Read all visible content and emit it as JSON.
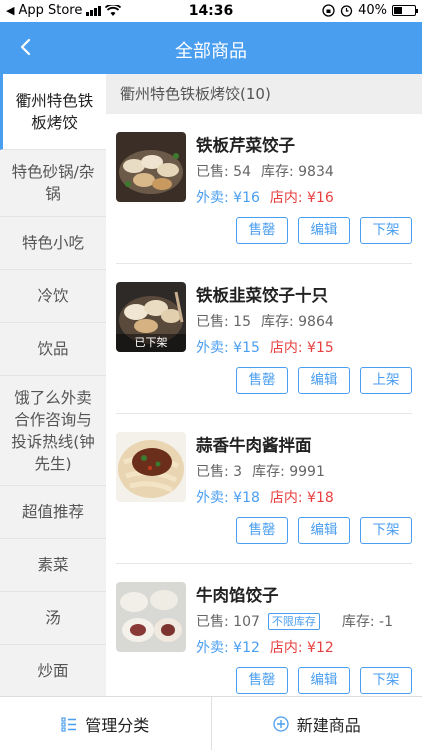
{
  "status_bar": {
    "carrier": "App Store",
    "time": "14:36",
    "battery": "40%",
    "battery_level": 0.4
  },
  "nav": {
    "title": "全部商品"
  },
  "sidebar": {
    "items": [
      {
        "label": "衢州特色铁板烤饺",
        "active": true
      },
      {
        "label": "特色砂锅/杂锅"
      },
      {
        "label": "特色小吃"
      },
      {
        "label": "冷饮"
      },
      {
        "label": "饮品"
      },
      {
        "label": "饿了么外卖合作咨询与投诉热线(钟先生)"
      },
      {
        "label": "超值推荐"
      },
      {
        "label": "素菜"
      },
      {
        "label": "汤"
      },
      {
        "label": "炒面"
      }
    ]
  },
  "section": {
    "title": "衢州特色铁板烤饺(10)"
  },
  "products": [
    {
      "name": "铁板芹菜饺子",
      "sold": "已售: 54",
      "stock": "库存: 9834",
      "takeout": "外卖: ¥16",
      "instore": "店内: ¥16",
      "buttons": [
        "售罄",
        "编辑",
        "下架"
      ],
      "delisted": ""
    },
    {
      "name": "铁板韭菜饺子十只",
      "sold": "已售: 15",
      "stock": "库存: 9864",
      "takeout": "外卖: ¥15",
      "instore": "店内: ¥15",
      "buttons": [
        "售罄",
        "编辑",
        "上架"
      ],
      "delisted": "已下架"
    },
    {
      "name": "蒜香牛肉酱拌面",
      "sold": "已售: 3",
      "stock": "库存: 9991",
      "takeout": "外卖: ¥18",
      "instore": "店内: ¥18",
      "buttons": [
        "售罄",
        "编辑",
        "下架"
      ],
      "delisted": ""
    },
    {
      "name": "牛肉馅饺子",
      "sold": "已售: 107",
      "unlimited": "不限库存",
      "stock": "库存: -1",
      "takeout": "外卖: ¥12",
      "instore": "店内: ¥12",
      "buttons": [
        "售罄",
        "编辑",
        "下架"
      ],
      "delisted": ""
    }
  ],
  "bottom": {
    "manage": "管理分类",
    "add": "新建商品"
  },
  "colors": {
    "accent": "#4a9ef0",
    "price_red": "#e84040"
  },
  "icons": [
    "back-arrow-icon",
    "list-icon",
    "plus-circle-icon",
    "wifi-icon",
    "battery-icon",
    "alarm-icon",
    "rotation-lock-icon"
  ]
}
